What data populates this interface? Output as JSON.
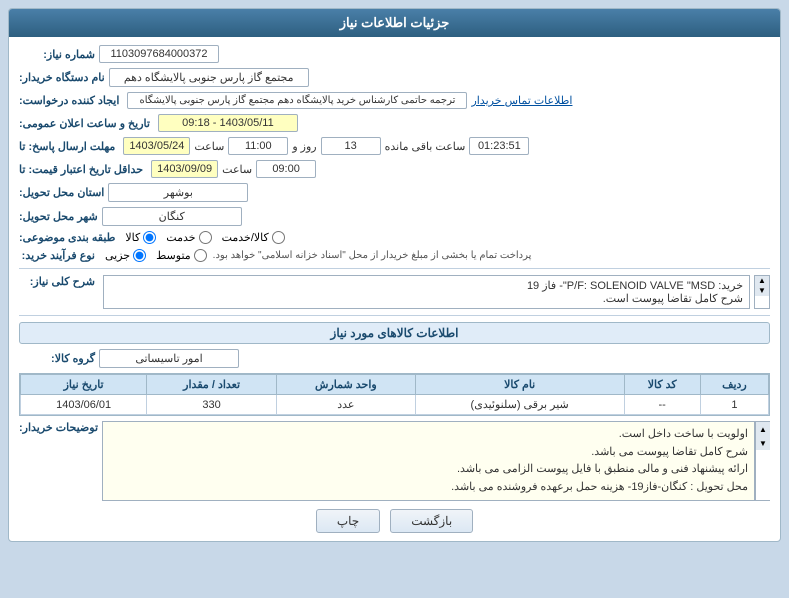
{
  "header": {
    "title": "جزئیات اطلاعات نیاز"
  },
  "fields": {
    "reference_number_label": "شماره نیاز:",
    "reference_number_value": "1103097684000372",
    "buyer_name_label": "نام دستگاه خریدار:",
    "buyer_name_value": "مجتمع گاز پارس جنوبی  پالایشگاه دهم",
    "creator_label": "ایجاد کننده درخواست:",
    "creator_value": "ترجمه حاتمی کارشناس خرید پالایشگاه دهم  مجتمع گاز پارس جنوبی  پالایشگاه",
    "creator_link": "اطلاعات تماس خریدار",
    "date_time_label": "تاریخ و ساعت اعلان عمومی:",
    "date_time_value": "1403/05/11 - 09:18",
    "send_deadline_label": "مهلت ارسال پاسخ: تا",
    "send_deadline_date": "1403/05/24",
    "send_deadline_time": "11:00",
    "send_deadline_days": "13",
    "send_deadline_remaining": "01:23:51",
    "price_deadline_label": "حداقل تاریخ اعتبار قیمت: تا",
    "price_deadline_date": "1403/09/09",
    "price_deadline_time": "09:00",
    "province_label": "استان محل تحویل:",
    "province_value": "بوشهر",
    "city_label": "شهر محل تحویل:",
    "city_value": "کنگان",
    "category_label": "طبقه بندی موضوعی:",
    "category_options": [
      "کالا",
      "خدمت",
      "کالا/خدمت"
    ],
    "category_selected": "کالا",
    "purchase_type_label": "نوع فرآیند خرید:",
    "purchase_type_options": [
      "جزیی",
      "متوسط"
    ],
    "purchase_type_note": "پرداخت تمام یا بخشی از مبلغ خریدار از محل \"اسناد خزانه اسلامی\" خواهد بود.",
    "need_description_label": "شرح کلی نیاز:",
    "need_description_purchase": "خرید: P/F: SOLENOID VALVE \"MSD\"- فاز 19",
    "need_description_note": "شرح کامل تقاضا پیوست است.",
    "goods_info_title": "اطلاعات کالاهای مورد نیاز",
    "goods_group_label": "گروه کالا:",
    "goods_group_value": "امور تاسیساتی",
    "table": {
      "headers": [
        "ردیف",
        "کد کالا",
        "نام کالا",
        "واحد شمارش",
        "تعداد / مقدار",
        "تاریخ نیاز"
      ],
      "rows": [
        {
          "row": "1",
          "code": "--",
          "name": "شیر برقی (سلنوئیدی)",
          "unit": "عدد",
          "quantity": "330",
          "date": "1403/06/01"
        }
      ]
    },
    "buyer_notes_label": "توضیحات خریدار:",
    "buyer_notes": [
      "اولویت با ساخت داخل است.",
      "شرح کامل تقاضا پیوست می باشد.",
      "ارائه پیشنهاد فنی و مالی منطبق با فایل پیوست الزامی می باشد.",
      "محل تحویل : کنگان-فاز19- هزینه حمل برعهده فروشنده می باشد."
    ]
  },
  "buttons": {
    "print_label": "چاپ",
    "back_label": "بازگشت"
  },
  "units": {
    "days": "روز و",
    "hour": "ساعت",
    "remaining": "ساعت باقی مانده"
  }
}
